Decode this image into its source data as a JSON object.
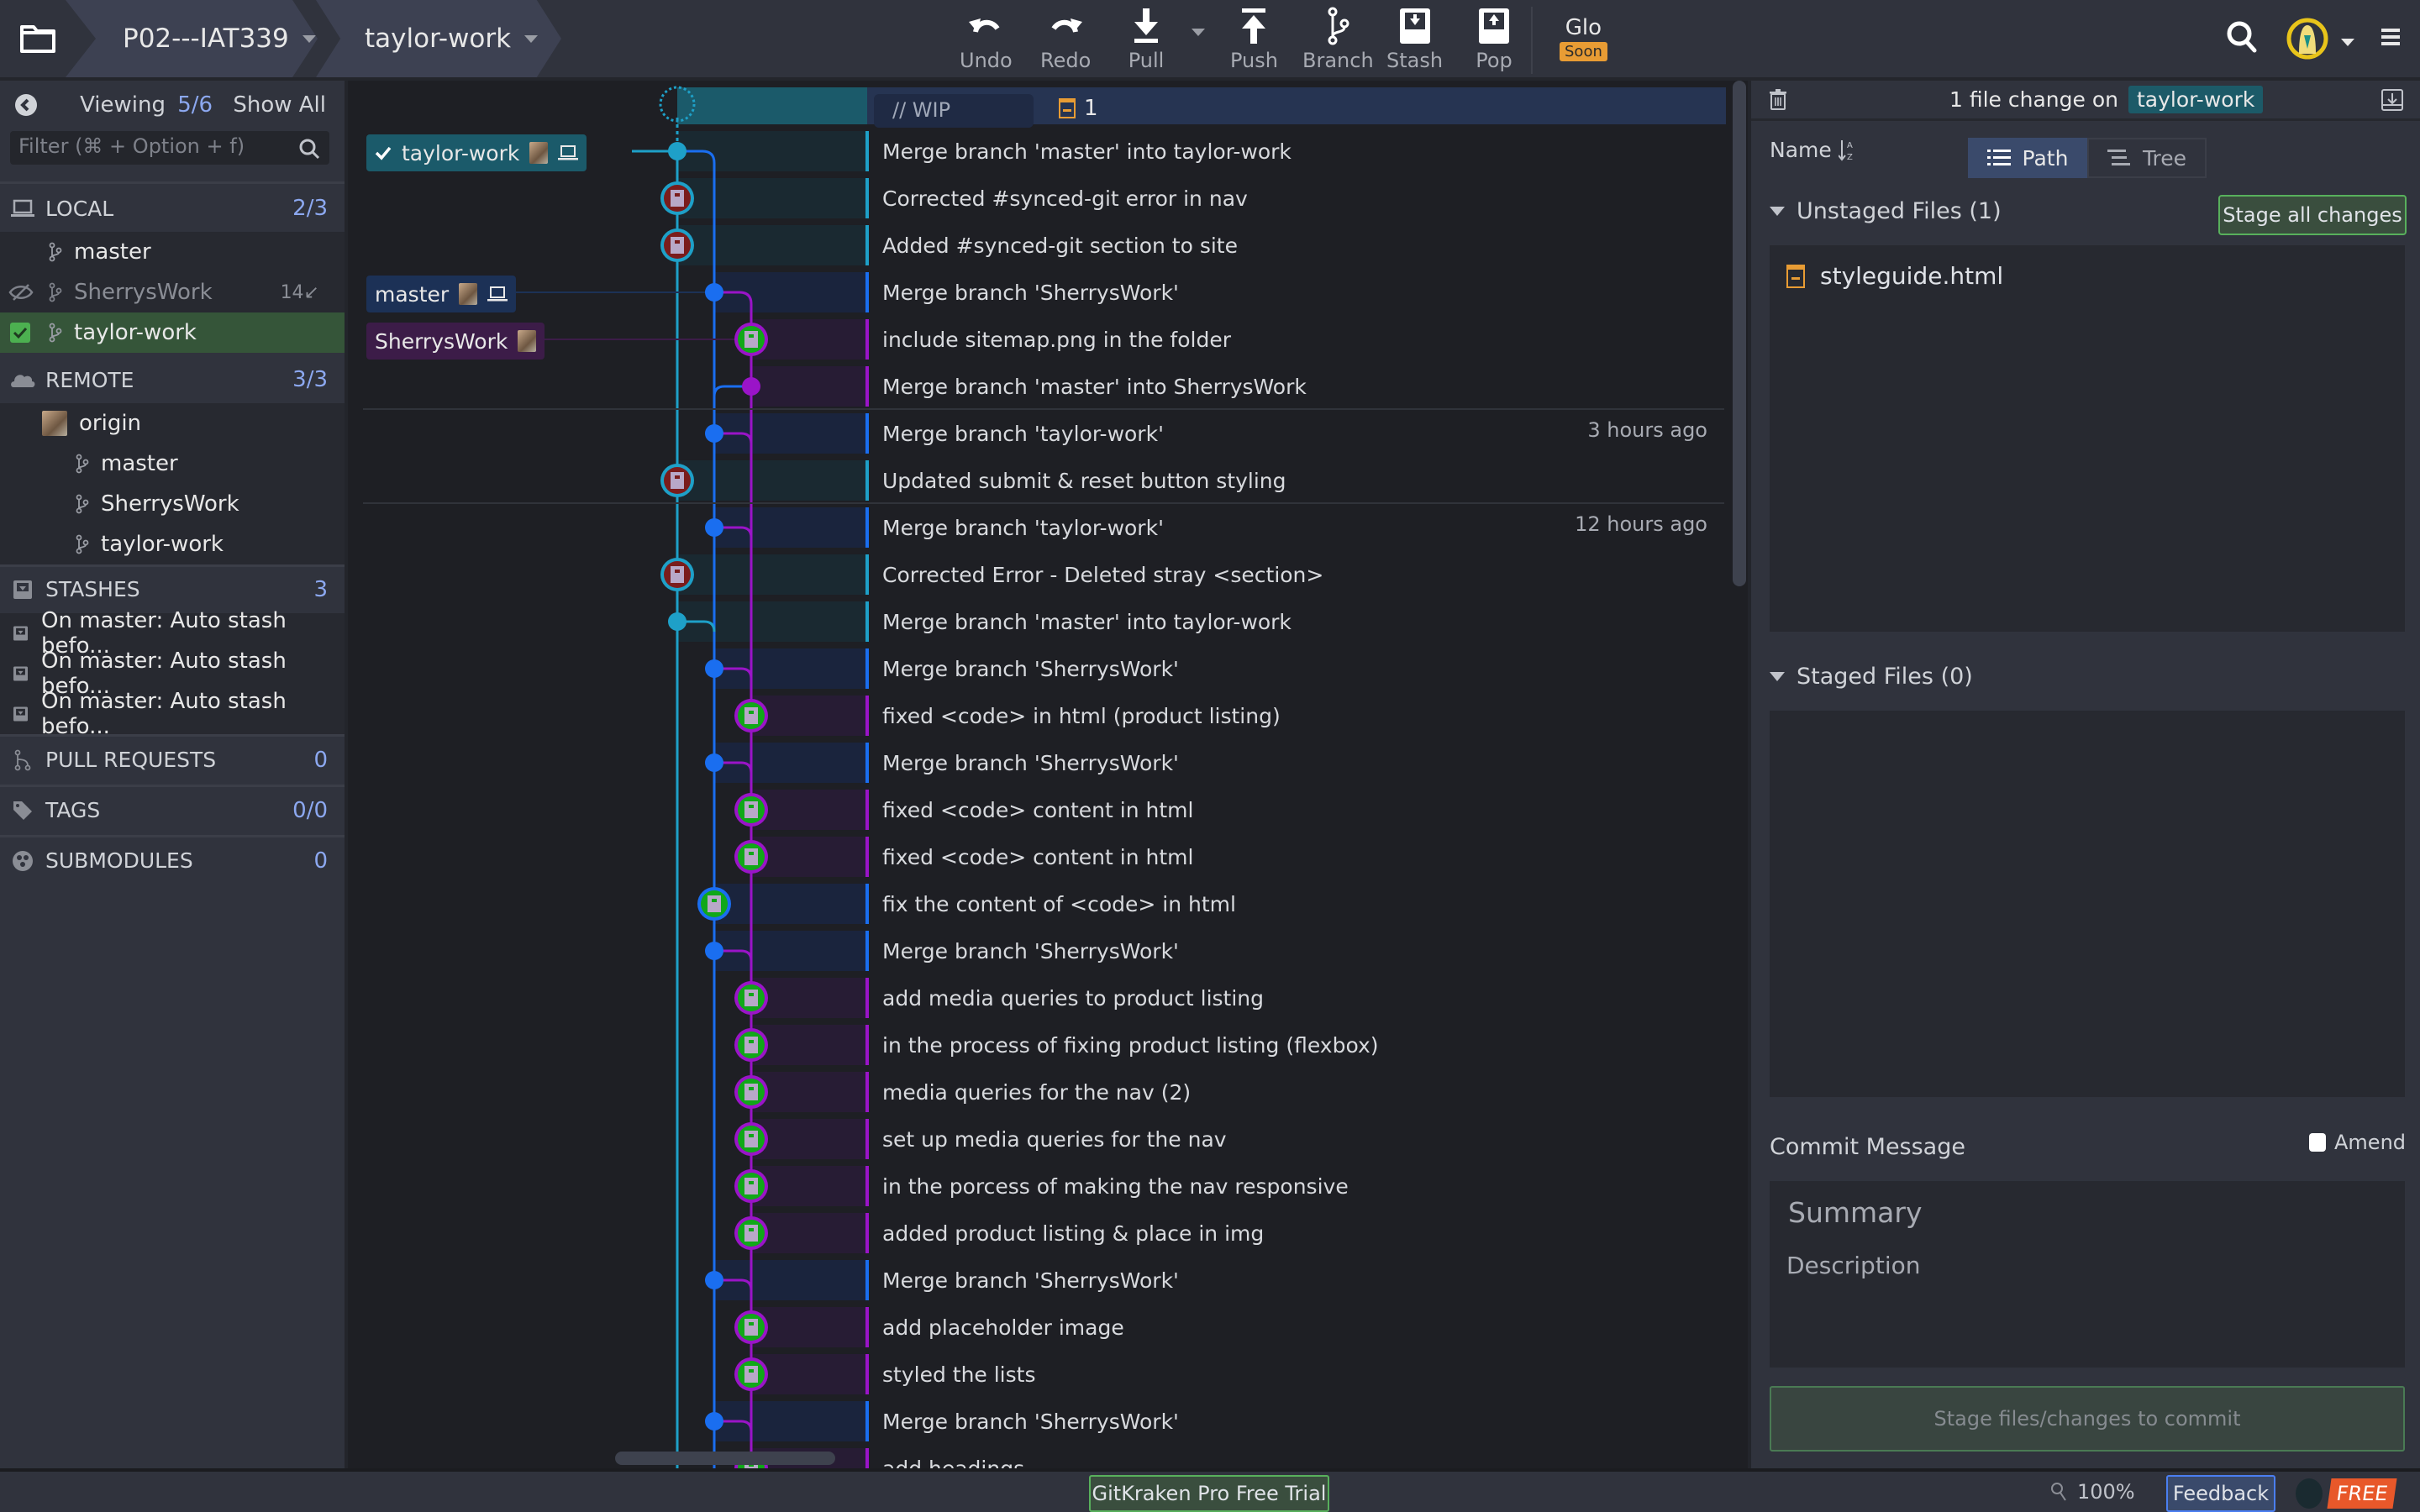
{
  "toolbar": {
    "repo": "P02---IAT339",
    "branch": "taylor-work",
    "buttons": {
      "undo": "Undo",
      "redo": "Redo",
      "pull": "Pull",
      "push": "Push",
      "branch": "Branch",
      "stash": "Stash",
      "pop": "Pop"
    },
    "glo": {
      "label": "Glo",
      "badge": "Soon"
    }
  },
  "sidebar": {
    "viewing_label": "Viewing",
    "viewing_count": "5/6",
    "show_all": "Show All",
    "filter_placeholder": "Filter (⌘ + Option + f)",
    "local": {
      "label": "LOCAL",
      "count": "2/3",
      "branches": [
        {
          "name": "master"
        },
        {
          "name": "SherrysWork",
          "behind": "14↙"
        },
        {
          "name": "taylor-work"
        }
      ]
    },
    "remote": {
      "label": "REMOTE",
      "count": "3/3",
      "origin": "origin",
      "branches": [
        {
          "name": "master"
        },
        {
          "name": "SherrysWork"
        },
        {
          "name": "taylor-work"
        }
      ]
    },
    "stashes": {
      "label": "STASHES",
      "count": "3",
      "items": [
        "On master: Auto stash befo...",
        "On master: Auto stash befo...",
        "On master: Auto stash befo..."
      ]
    },
    "pull_requests": {
      "label": "PULL REQUESTS",
      "count": "0"
    },
    "tags": {
      "label": "TAGS",
      "count": "0/0"
    },
    "submodules": {
      "label": "SUBMODULES",
      "count": "0"
    }
  },
  "graph": {
    "wip_placeholder": "// WIP",
    "wip_file_count": "1",
    "refs": {
      "taylor_work": "taylor-work",
      "master": "master",
      "sherrys_work": "SherrysWork"
    },
    "colors": {
      "taylor_work": "#1ea0c8",
      "master": "#1a6ef0",
      "sherrys_work": "#9a14c8"
    },
    "commits": [
      {
        "message": "Merge branch 'master' into taylor-work",
        "lane": 0,
        "type": "merge",
        "time": ""
      },
      {
        "message": "Corrected #synced-git error in nav",
        "lane": 0,
        "type": "avatar-red",
        "time": ""
      },
      {
        "message": "Added #synced-git section to site",
        "lane": 0,
        "type": "avatar-red",
        "time": ""
      },
      {
        "message": "Merge branch 'SherrysWork'",
        "lane": 1,
        "type": "merge",
        "time": ""
      },
      {
        "message": "include sitemap.png in the folder",
        "lane": 2,
        "type": "avatar-green",
        "time": ""
      },
      {
        "message": "Merge branch 'master' into SherrysWork",
        "lane": 2,
        "type": "merge",
        "time": ""
      },
      {
        "message": "Merge branch 'taylor-work'",
        "lane": 1,
        "type": "merge",
        "time": "3 hours ago"
      },
      {
        "message": "Updated submit & reset button styling",
        "lane": 0,
        "type": "avatar-red",
        "time": ""
      },
      {
        "message": "Merge branch 'taylor-work'",
        "lane": 1,
        "type": "merge",
        "time": "12 hours ago"
      },
      {
        "message": "Corrected Error - Deleted stray <section>",
        "lane": 0,
        "type": "avatar-red",
        "time": ""
      },
      {
        "message": "Merge branch 'master' into taylor-work",
        "lane": 0,
        "type": "merge",
        "time": ""
      },
      {
        "message": "Merge branch 'SherrysWork'",
        "lane": 1,
        "type": "merge",
        "time": ""
      },
      {
        "message": "fixed <code> in html (product listing)",
        "lane": 2,
        "type": "avatar-green",
        "time": ""
      },
      {
        "message": "Merge branch 'SherrysWork'",
        "lane": 1,
        "type": "merge",
        "time": ""
      },
      {
        "message": "fixed <code> content in html",
        "lane": 2,
        "type": "avatar-green",
        "time": ""
      },
      {
        "message": "fixed <code> content in html",
        "lane": 2,
        "type": "avatar-green",
        "time": ""
      },
      {
        "message": "fix the content of <code> in html",
        "lane": 1,
        "type": "avatar-green",
        "time": ""
      },
      {
        "message": "Merge branch 'SherrysWork'",
        "lane": 1,
        "type": "merge",
        "time": ""
      },
      {
        "message": "add media queries to product listing",
        "lane": 2,
        "type": "avatar-green",
        "time": ""
      },
      {
        "message": "in the process of fixing product listing (flexbox)",
        "lane": 2,
        "type": "avatar-green",
        "time": ""
      },
      {
        "message": "media queries for the nav (2)",
        "lane": 2,
        "type": "avatar-green",
        "time": ""
      },
      {
        "message": "set up media queries for the nav",
        "lane": 2,
        "type": "avatar-green",
        "time": ""
      },
      {
        "message": "in the porcess of making the nav responsive",
        "lane": 2,
        "type": "avatar-green",
        "time": ""
      },
      {
        "message": "added product listing & place in img",
        "lane": 2,
        "type": "avatar-green",
        "time": ""
      },
      {
        "message": "Merge branch 'SherrysWork'",
        "lane": 1,
        "type": "merge",
        "time": ""
      },
      {
        "message": "add placeholder image",
        "lane": 2,
        "type": "avatar-green",
        "time": ""
      },
      {
        "message": "styled the lists",
        "lane": 2,
        "type": "avatar-green",
        "time": ""
      },
      {
        "message": "Merge branch 'SherrysWork'",
        "lane": 1,
        "type": "merge",
        "time": ""
      },
      {
        "message": "add headings",
        "lane": 2,
        "type": "avatar-green",
        "time": ""
      }
    ]
  },
  "panel": {
    "header_prefix": "1 file change on",
    "header_branch": "taylor-work",
    "sort_label": "Name",
    "view_path": "Path",
    "view_tree": "Tree",
    "unstaged_label": "Unstaged Files (1)",
    "stage_all": "Stage all changes",
    "unstaged_files": [
      "styleguide.html"
    ],
    "staged_label": "Staged Files (0)",
    "commit_label": "Commit Message",
    "amend_label": "Amend",
    "summary_placeholder": "Summary",
    "description_placeholder": "Description",
    "commit_button": "Stage files/changes to commit"
  },
  "statusbar": {
    "trial": "GitKraken Pro Free Trial",
    "zoom": "100%",
    "feedback": "Feedback",
    "plan": "FREE"
  }
}
